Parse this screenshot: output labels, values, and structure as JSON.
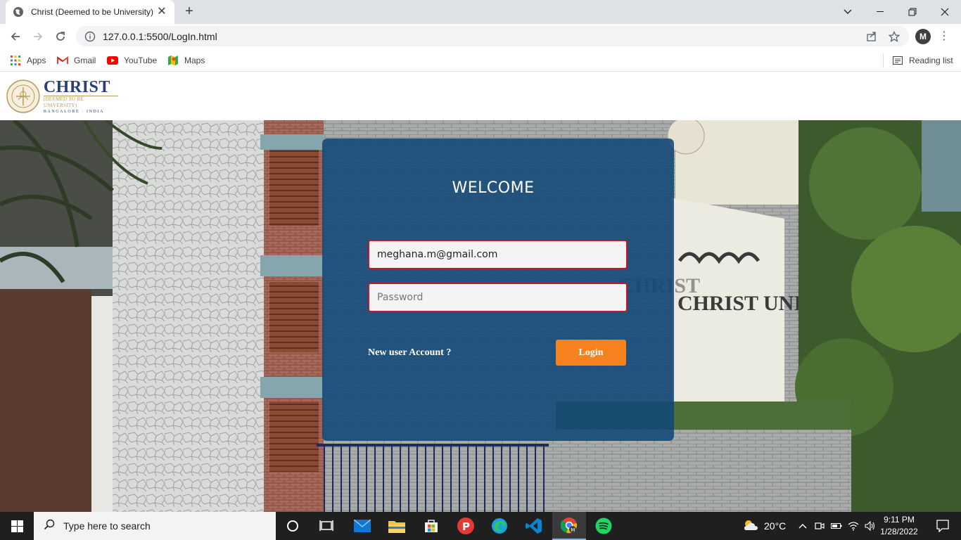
{
  "browser": {
    "tab_title": "Christ (Deemed to be University)",
    "url": "127.0.0.1:5500/LogIn.html",
    "profile_initial": "M",
    "bookmarks": [
      {
        "label": "Apps",
        "icon": "apps-grid-icon"
      },
      {
        "label": "Gmail",
        "icon": "gmail-icon"
      },
      {
        "label": "YouTube",
        "icon": "youtube-icon"
      },
      {
        "label": "Maps",
        "icon": "maps-icon"
      }
    ],
    "reading_list": "Reading list"
  },
  "site": {
    "logo_name": "CHRIST",
    "logo_subtitle": "(DEEMED TO BE UNIVERSITY)",
    "logo_location": "BANGALORE · INDIA"
  },
  "login": {
    "heading": "WELCOME",
    "email_value": "meghana.m@gmail.com",
    "password_placeholder": "Password",
    "new_user_link": "New user Account ?",
    "login_button": "Login"
  },
  "colors": {
    "card": "#114876",
    "field_border": "#c4182a",
    "login_button": "#f5821f",
    "logo_blue": "#2a3f7a"
  },
  "taskbar": {
    "search_placeholder": "Type here to search",
    "weather": "20°C",
    "time": "9:11 PM",
    "date": "1/28/2022"
  }
}
